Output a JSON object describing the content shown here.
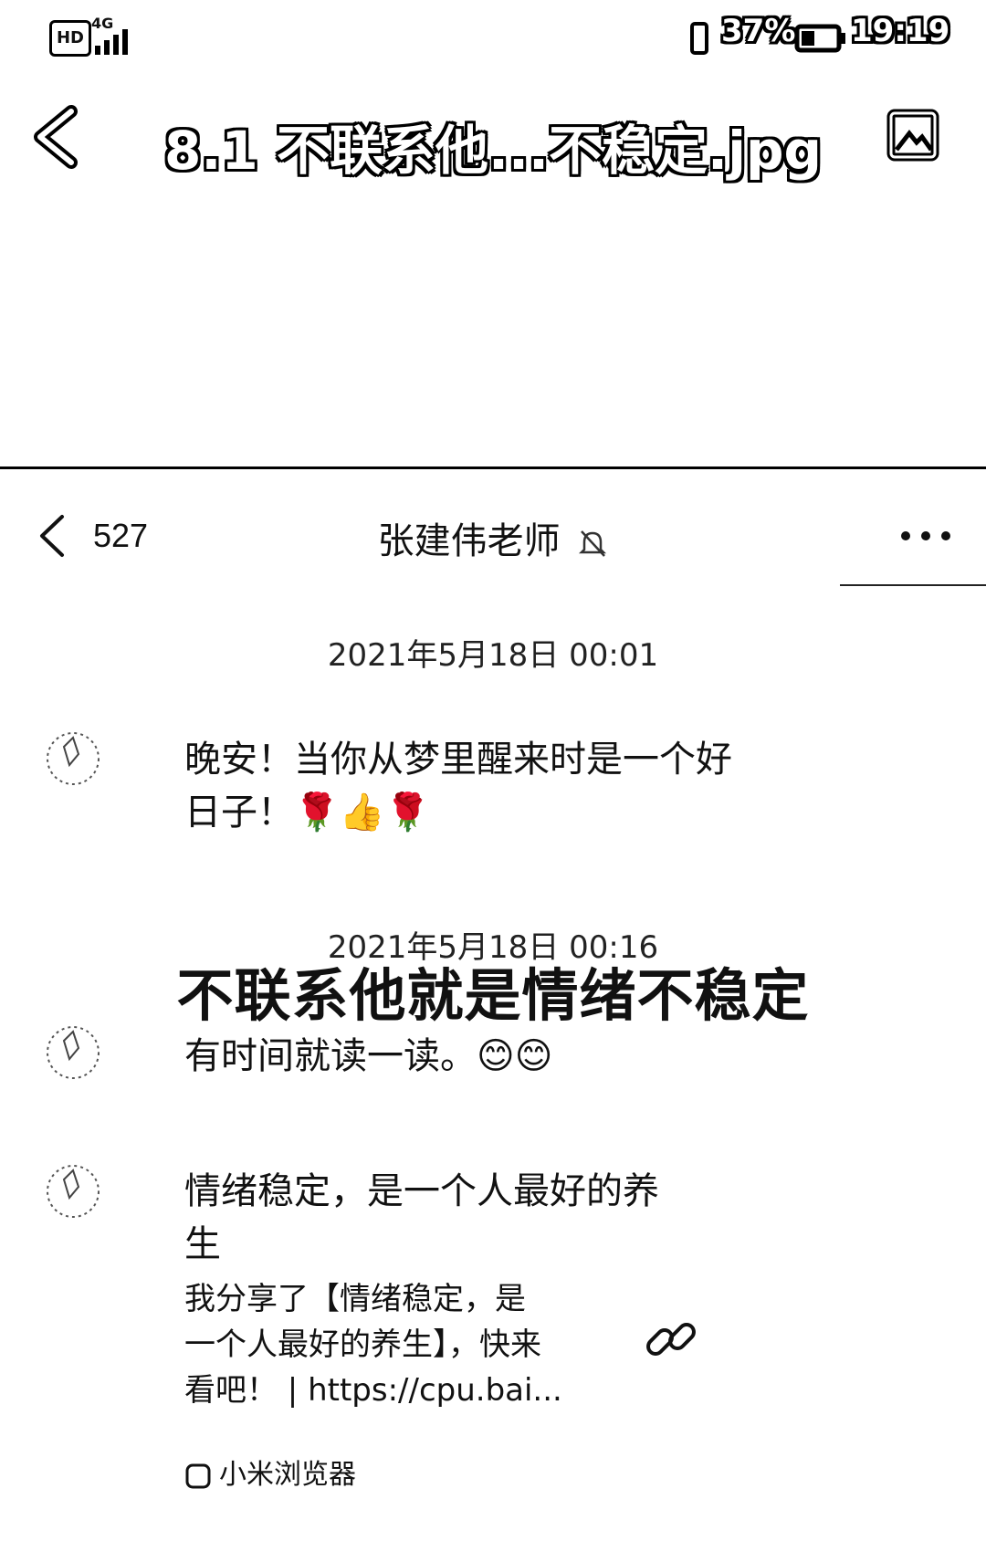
{
  "status_bar": {
    "hd": "HD",
    "network": "4G",
    "battery_percent": "37%",
    "time": "19:19"
  },
  "viewer": {
    "title": "8.1 不联系他...不稳定.jpg"
  },
  "chat": {
    "unread_count": "527",
    "contact_name": "张建伟老师",
    "messages": [
      {
        "timestamp": "2021年5月18日 00:01",
        "text_line1": "晚安！当你从梦里醒来时是一个好",
        "text_line2": "日子！🌹👍🌹"
      },
      {
        "timestamp": "2021年5月18日 00:16",
        "text": "有时间就读一读。😊😊"
      },
      {
        "text_line1": "情绪稳定，是一个人最好的养",
        "text_line2": "生",
        "link_line1": "我分享了【情绪稳定，是",
        "link_line2": "一个人最好的养生】，快来",
        "link_line3": "看吧！ | https://cpu.bai...",
        "source": "小米浏览器"
      }
    ]
  },
  "overlay_caption": "不联系他就是情绪不稳定",
  "icons": {
    "back": "chevron-left-icon",
    "chat_back": "chevron-left-icon",
    "mute": "bell-off-icon",
    "more": "more-dots-icon",
    "image": "image-icon",
    "link": "link-icon",
    "browser": "browser-icon"
  }
}
